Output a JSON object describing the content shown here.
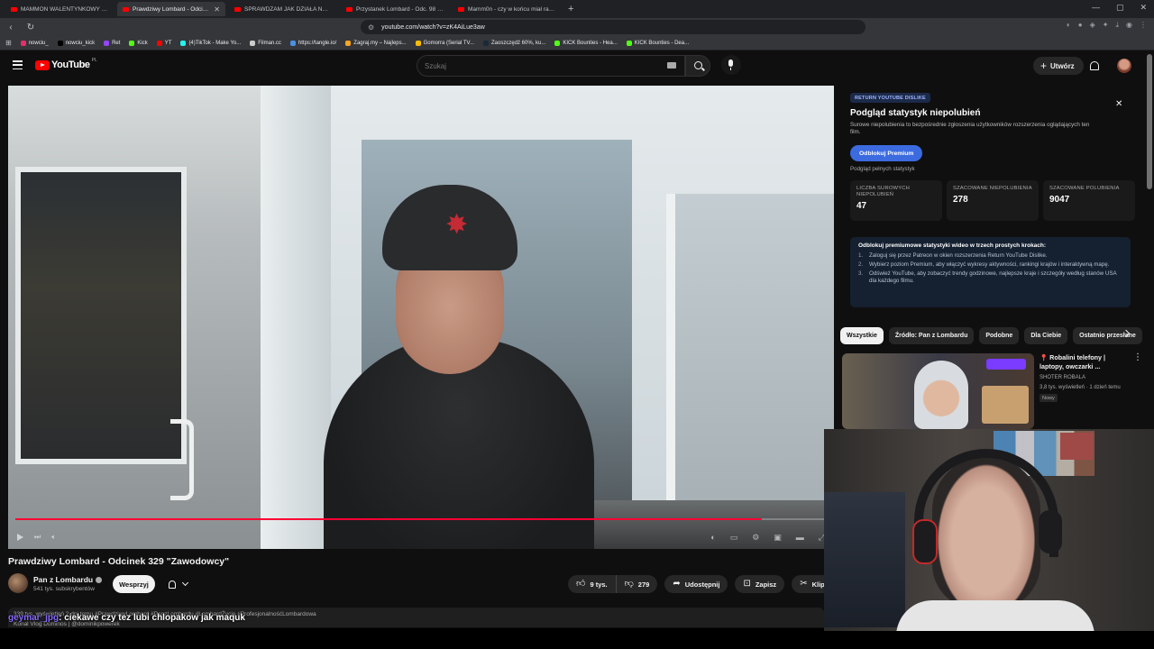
{
  "browser": {
    "tabs": [
      {
        "label": "MAMMON WALENTYNKOWY MIXTAPE",
        "active": false
      },
      {
        "label": "Prawdziwy Lombard - Odcinek",
        "active": true
      },
      {
        "label": "SPRAWDZAM JAK DZIAŁA NAJSŁYNN",
        "active": false
      },
      {
        "label": "Przystanek Lombard - Odc. 98 \"Nowe",
        "active": false
      },
      {
        "label": "Mamm0n - czy w końcu miał racje?",
        "active": false
      }
    ],
    "url": "youtube.com/watch?v=zK4AiLue3aw",
    "bookmarks": [
      {
        "label": "nowciu_",
        "color": "#e1306c"
      },
      {
        "label": "nowciu_kick",
        "color": "#000000"
      },
      {
        "label": "Ret",
        "color": "#9146ff"
      },
      {
        "label": "Kick",
        "color": "#53fc18"
      },
      {
        "label": "YT",
        "color": "#ff0000"
      },
      {
        "label": "(4)TikTok - Make Yo...",
        "color": "#25f4ee"
      },
      {
        "label": "Filman.cc",
        "color": "#cccccc"
      },
      {
        "label": "https://tangle.io/",
        "color": "#4a90e2"
      },
      {
        "label": "Zagraj.my – Najleps...",
        "color": "#f5a623"
      },
      {
        "label": "Gomorra (Serial TV...",
        "color": "#fbbc05"
      },
      {
        "label": "Zaoszczędź 60%, ku...",
        "color": "#1b2838"
      },
      {
        "label": "KICK Bounties - Hea...",
        "color": "#53fc18"
      },
      {
        "label": "KICK Bounties - Dea...",
        "color": "#53fc18"
      }
    ]
  },
  "header": {
    "logo_text": "YouTube",
    "logo_country": "PL",
    "search_placeholder": "Szukaj",
    "create_label": "Utwórz"
  },
  "player": {
    "progress": 0.92
  },
  "video": {
    "title": "Prawdziwy Lombard - Odcinek 329 \"Zawodowcy\"",
    "channel": "Pan z Lombardu",
    "subscribers": "541 tys. subskrybentów",
    "support_label": "Wesprzyj",
    "likes": "9 tys.",
    "dislikes": "279",
    "share_label": "Udostępnij",
    "save_label": "Zapisz",
    "clip_label": "Klip",
    "description_line1": "339 tys. wyświetleń  2 dni temu  #PrawdziwyLombard #PanzLombardu #LombardŻycie #ProfesjonalnośćLombardowa",
    "description_line2": "Konal Vlog Dominos   |   @dominikpowerek"
  },
  "chat": {
    "user": "geymar_jpg",
    "message": ": ciekawe czy tez lubi chlopakow jak maquk"
  },
  "ryd": {
    "badge": "RETURN YOUTUBE DISLIKE",
    "title": "Podgląd statystyk niepolubień",
    "description": "Surowe niepolubienia to bezpośrednie zgłoszenia użytkowników rozszerzenia oglądających ten film.",
    "unlock_label": "Odblokuj Premium",
    "full_stats_label": "Podgląd pełnych statystyk",
    "stats": [
      {
        "label": "Liczba surowych niepolubień",
        "value": "47"
      },
      {
        "label": "Szacowane niepolubienia",
        "value": "278"
      },
      {
        "label": "Szacowane polubienia",
        "value": "9047"
      }
    ],
    "steps_heading": "Odblokuj premiumowe statystyki wideo w trzech prostych krokach:",
    "steps": [
      "Zaloguj się przez Patreon w okien rozszerzenia Return YouTube Dislike.",
      "Wybierz poziom Premium, aby włączyć wykresy aktywności, rankingi krajów i interaktywną mapę.",
      "Odśwież YouTube, aby zobaczyć trendy godzinowe, najlepsze kraje i szczegóły według stanów USA dla każdego filmu."
    ]
  },
  "chips": [
    "Wszystkie",
    "Źródło: Pan z Lombardu",
    "Podobne",
    "Dla Ciebie",
    "Ostatnio przesłane"
  ],
  "recommendation": {
    "title": "Robalini telefony | laptopy, owczarki ...",
    "channel": "SHOTER ROBALA",
    "meta": "3,8 tys. wyświetleń · 1 dzień temu",
    "badge": "Nowy"
  }
}
